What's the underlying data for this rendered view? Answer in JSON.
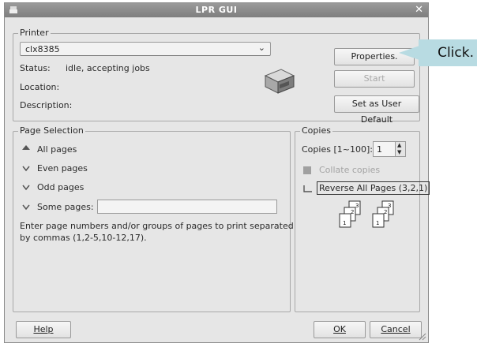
{
  "window": {
    "title": "LPR GUI"
  },
  "printer": {
    "group_label": "Printer",
    "selected": "clx8385",
    "status_label": "Status:",
    "status_value": "idle, accepting jobs",
    "location_label": "Location:",
    "description_label": "Description:",
    "properties_button": "Properties.",
    "start_button": "Start",
    "default_button": "Set as User Default"
  },
  "page_selection": {
    "group_label": "Page Selection",
    "all_pages": "All pages",
    "even_pages": "Even pages",
    "odd_pages": "Odd pages",
    "some_pages": "Some pages:",
    "some_pages_value": "",
    "hint_line1": "Enter page numbers and/or groups of pages to print separated",
    "hint_line2": "by commas (1,2-5,10-12,17)."
  },
  "copies": {
    "group_label": "Copies",
    "copies_label": "Copies [1~100]:",
    "copies_value": "1",
    "collate_label": "Collate copies",
    "reverse_label": "Reverse All Pages (3,2,1)",
    "page_numbers": [
      "3",
      "2",
      "1"
    ]
  },
  "footer": {
    "help_button": "Help",
    "ok_button": "OK",
    "cancel_button": "Cancel"
  },
  "callout": {
    "text": "Click."
  },
  "colors": {
    "window_bg": "#e6e6e6",
    "titlebar": "#8a8a8a",
    "callout_bg": "#b8dbe2"
  }
}
